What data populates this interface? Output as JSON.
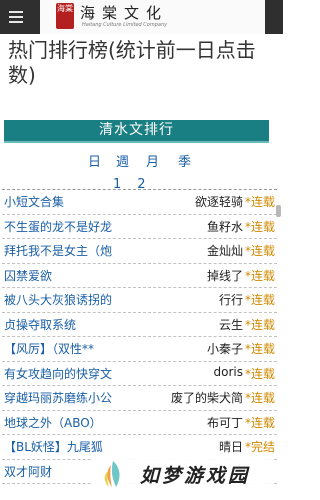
{
  "header": {
    "seal_text": "海棠",
    "brand_cn": "海棠文化",
    "brand_en": "Haitang Culture Limited Company"
  },
  "page_title": "热门排行榜(统计前一日点击数)",
  "section_title": "清水文排行",
  "period_tabs": [
    "日",
    "週",
    "月",
    "季"
  ],
  "page_links": [
    "1",
    "2"
  ],
  "rankings": [
    {
      "title": "小短文合集",
      "author": "欲逐轻骑",
      "status": "*连载"
    },
    {
      "title": "不生蛋的龙不是好龙",
      "author": "鱼籽水",
      "status": "*连载"
    },
    {
      "title": "拜托我不是女主（炮",
      "author": "金灿灿",
      "status": "*连载"
    },
    {
      "title": "囚禁爱欲",
      "author": "掉线了",
      "status": "*连载"
    },
    {
      "title": "被八头大灰狼诱拐的",
      "author": "行行",
      "status": "*连载"
    },
    {
      "title": "贞操夺取系统",
      "author": "云生",
      "status": "*连载"
    },
    {
      "title": "【风厉】（双性**",
      "author": "小秦子",
      "status": "*连载"
    },
    {
      "title": "有女攻趋向的快穿文",
      "author": "doris",
      "status": "*连载"
    },
    {
      "title": "穿越玛丽苏磨练小公",
      "author": "废了的柴犬简",
      "status": "*连载"
    },
    {
      "title": "地球之外（ABO）",
      "author": "布可丁",
      "status": "*连载"
    },
    {
      "title": "【BL妖怪】九尾狐",
      "author": "晴日",
      "status": "*完结"
    },
    {
      "title": "双才阿财",
      "author": "",
      "status": ""
    }
  ],
  "watermark": {
    "text": "如梦游戏园",
    "icon": "feather-icon"
  }
}
